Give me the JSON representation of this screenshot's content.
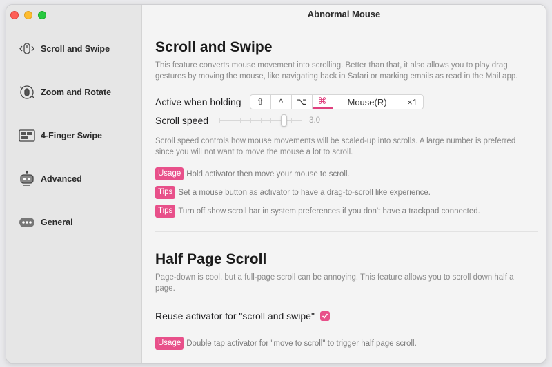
{
  "window": {
    "title": "Abnormal Mouse"
  },
  "sidebar": {
    "items": [
      {
        "label": "Scroll and Swipe",
        "icon": "mouse-scroll-icon"
      },
      {
        "label": "Zoom and Rotate",
        "icon": "zoom-rotate-icon"
      },
      {
        "label": "4-Finger Swipe",
        "icon": "mission-control-icon"
      },
      {
        "label": "Advanced",
        "icon": "robot-icon"
      },
      {
        "label": "General",
        "icon": "more-icon"
      }
    ]
  },
  "scroll_section": {
    "title": "Scroll and Swipe",
    "description": "This feature converts mouse movement into scrolling. Better than that, it also allows you to play drag gestures by moving the mouse, like navigating back in Safari or marking emails as read in the Mail app.",
    "active_label": "Active when holding",
    "keys": [
      "⇧",
      "^",
      "⌥",
      "⌘",
      "Mouse(R)",
      "×1"
    ],
    "active_key_index": 3,
    "speed_label": "Scroll speed",
    "speed_value": "3.0",
    "speed_fraction": 0.8,
    "speed_description": "Scroll speed controls how mouse movements will be scaled-up into scrolls. A large number is preferred since you will not want to move the mouse a lot to scroll.",
    "tips": [
      {
        "badge": "Usage",
        "text": "Hold activator then move your mouse to scroll."
      },
      {
        "badge": "Tips",
        "text": "Set a mouse button as activator to have a drag-to-scroll like experience."
      },
      {
        "badge": "Tips",
        "text": "Turn off show scroll bar in system preferences if you don't have a trackpad connected."
      }
    ]
  },
  "half_page_section": {
    "title": "Half Page Scroll",
    "description": "Page-down is cool, but a full-page scroll can be annoying. This feature allows you to scroll down half a page.",
    "reuse_label": "Reuse activator for \"scroll and swipe\"",
    "reuse_checked": true,
    "tips": [
      {
        "badge": "Usage",
        "text": "Double tap activator for \"move to scroll\" to trigger half page scroll."
      }
    ]
  },
  "colors": {
    "accent": "#e8508a",
    "sidebar_bg": "#e6e6e6",
    "content_bg": "#f4f4f4"
  }
}
